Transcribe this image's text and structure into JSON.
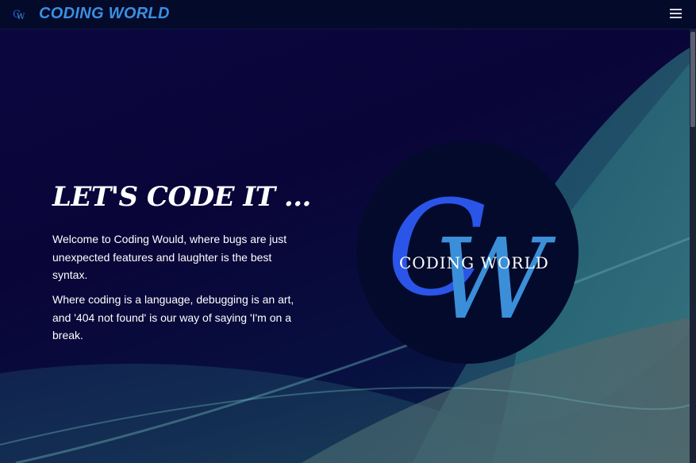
{
  "navbar": {
    "brand": "CODING WORLD",
    "logo_icon": "cw-logo-icon",
    "menu_icon": "hamburger-menu-icon"
  },
  "hero": {
    "heading": "LET'S CODE IT ...",
    "paragraph1": "Welcome to Coding Would, where bugs are just unexpected features and laughter is the best syntax.",
    "paragraph2": "Where coding is a language, debugging is an art, and '404 not found' is our way of saying 'I'm on a break."
  },
  "logo": {
    "text": "CODING WORLD",
    "letter_c": "C",
    "letter_w": "W"
  },
  "colors": {
    "brand": "#3a8fe0",
    "background": "#0a0538",
    "logo_c": "#2a55e8",
    "logo_w": "#3b8fd8"
  }
}
